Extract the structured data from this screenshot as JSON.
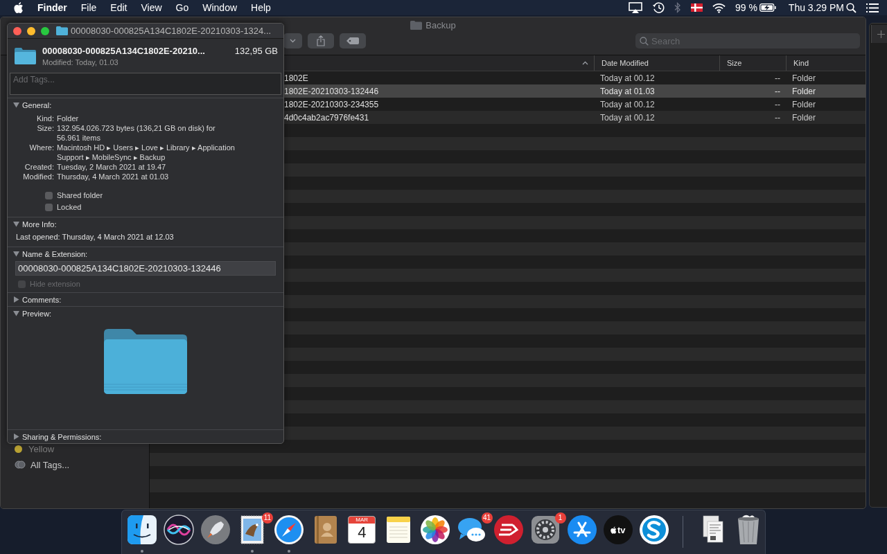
{
  "menubar": {
    "app_name": "Finder",
    "menus": [
      "File",
      "Edit",
      "View",
      "Go",
      "Window",
      "Help"
    ],
    "battery": "99 %",
    "clock": "Thu 3.29 PM"
  },
  "finder_window": {
    "title": "Backup",
    "search": {
      "placeholder": "Search"
    },
    "columns": [
      {
        "label": "Date Modified"
      },
      {
        "label": "Size"
      },
      {
        "label": "Kind"
      }
    ],
    "rows": [
      {
        "name": "1802E",
        "date_modified": "Today at 00.12",
        "size": "--",
        "kind": "Folder",
        "selected": false
      },
      {
        "name": "1802E-20210303-132446",
        "date_modified": "Today at 01.03",
        "size": "--",
        "kind": "Folder",
        "selected": true
      },
      {
        "name": "1802E-20210303-234355",
        "date_modified": "Today at 00.12",
        "size": "--",
        "kind": "Folder",
        "selected": false
      },
      {
        "name": "4d0c4ab2ac7976fe431",
        "date_modified": "Today at 00.12",
        "size": "--",
        "kind": "Folder",
        "selected": false
      }
    ],
    "sidebar_tags": [
      {
        "label": "Yellow",
        "kind": "tag",
        "color": "#b8a133"
      },
      {
        "label": "All Tags...",
        "kind": "all"
      }
    ]
  },
  "inspector": {
    "title": "00008030-000825A134C1802E-20210303-1324...",
    "name": "00008030-000825A134C1802E-20210...",
    "size": "132,95 GB",
    "modified": "Modified: Today, 01.03",
    "tags_placeholder": "Add Tags...",
    "sections": [
      {
        "kind": "general",
        "title": "General:",
        "expanded": true,
        "fields": [
          {
            "label": "Kind:",
            "value": "Folder"
          },
          {
            "label": "Size:",
            "value": "132.954.026.723 bytes (136,21 GB on disk) for 56.961 items"
          },
          {
            "label": "Where:",
            "value": "Macintosh HD ▸ Users ▸ Love ▸ Library ▸ Application Support ▸ MobileSync ▸ Backup"
          },
          {
            "label": "Created:",
            "value": "Tuesday, 2 March 2021 at 19.47"
          },
          {
            "label": "Modified:",
            "value": "Thursday, 4 March 2021 at 01.03"
          }
        ],
        "checkboxes": [
          {
            "label": "Shared folder",
            "checked": false,
            "disabled": false
          },
          {
            "label": "Locked",
            "checked": false,
            "disabled": false
          }
        ]
      },
      {
        "kind": "more_info",
        "title": "More Info:",
        "expanded": true,
        "text": "Last opened: Thursday, 4 March 2021 at 12.03"
      },
      {
        "kind": "name",
        "title": "Name & Extension:",
        "expanded": true,
        "value": "00008030-000825A134C1802E-20210303-132446",
        "checkboxes": [
          {
            "label": "Hide extension",
            "checked": false,
            "disabled": true
          }
        ]
      },
      {
        "kind": "comments",
        "title": "Comments:",
        "expanded": false
      },
      {
        "kind": "preview",
        "title": "Preview:",
        "expanded": true
      },
      {
        "kind": "sharing",
        "title": "Sharing & Permissions:",
        "expanded": false
      }
    ]
  },
  "dock": {
    "apps": [
      {
        "kind": "face",
        "running": true
      },
      {
        "kind": "orb",
        "running": false
      },
      {
        "kind": "rocket",
        "running": false
      },
      {
        "kind": "stamp",
        "badge": "11",
        "running": true
      },
      {
        "kind": "compass",
        "running": true
      },
      {
        "kind": "book",
        "running": false
      },
      {
        "kind": "calendar",
        "month": "MAR",
        "day": "4",
        "running": false
      },
      {
        "kind": "notepad",
        "running": false
      },
      {
        "kind": "flower",
        "running": false
      },
      {
        "kind": "chat",
        "badge": "41",
        "running": false
      },
      {
        "kind": "vpn",
        "running": false
      },
      {
        "kind": "gear",
        "badge": "1",
        "running": false
      },
      {
        "kind": "store",
        "running": false
      },
      {
        "kind": "tv",
        "label": "tv",
        "running": false
      },
      {
        "kind": "swirl",
        "running": false
      }
    ],
    "others": [
      {
        "kind": "documents"
      },
      {
        "kind": "trash"
      }
    ]
  }
}
